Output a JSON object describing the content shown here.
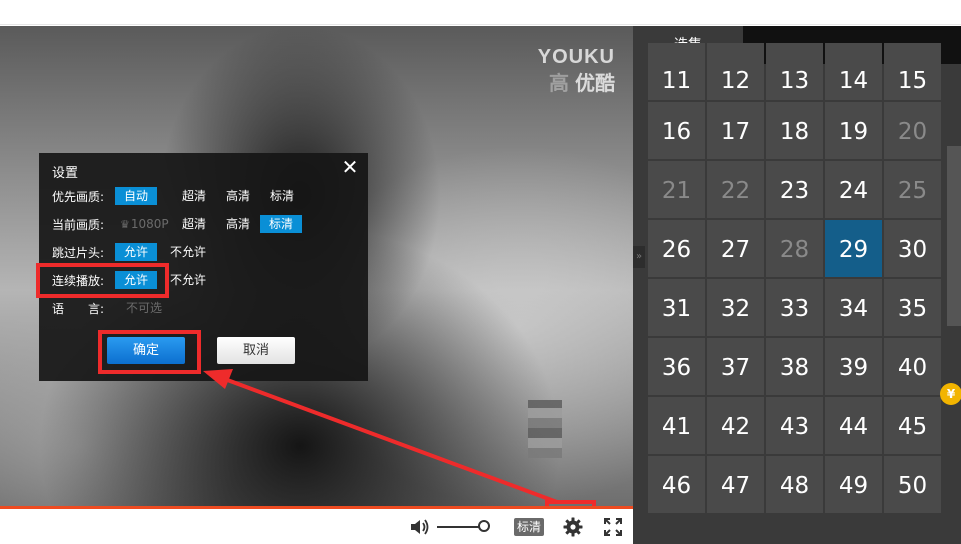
{
  "watermark": {
    "brand_en": "YOUKU",
    "brand_faded": "高",
    "brand_cn": "优酷"
  },
  "settings": {
    "title": "设置",
    "close_glyph": "✕",
    "rows": {
      "preferred_quality": {
        "label": "优先画质:",
        "options": [
          "自动",
          "超清",
          "高清",
          "标清"
        ],
        "selected": "自动"
      },
      "current_quality": {
        "label": "当前画质:",
        "crown_glyph": "♛",
        "options": [
          "1080P",
          "超清",
          "高清",
          "标清"
        ],
        "selected": "标清"
      },
      "skip_intro": {
        "label": "跳过片头:",
        "options": [
          "允许",
          "不允许"
        ],
        "selected": "允许"
      },
      "continuous_play": {
        "label": "连续播放:",
        "options": [
          "允许",
          "不允许"
        ],
        "selected": "允许"
      },
      "language": {
        "label": "语　　言:",
        "value": "不可选"
      }
    },
    "confirm_label": "确定",
    "cancel_label": "取消"
  },
  "controls": {
    "quality_label": "标清"
  },
  "episodes": {
    "tab_label": "选集",
    "rows": [
      [
        11,
        12,
        13,
        14,
        15
      ],
      [
        16,
        17,
        18,
        19,
        20
      ],
      [
        21,
        22,
        23,
        24,
        25
      ],
      [
        26,
        27,
        28,
        29,
        30
      ],
      [
        31,
        32,
        33,
        34,
        35
      ],
      [
        36,
        37,
        38,
        39,
        40
      ],
      [
        41,
        42,
        43,
        44,
        45
      ],
      [
        46,
        47,
        48,
        49,
        50
      ]
    ],
    "unavailable": [
      20,
      21,
      22,
      25,
      28
    ],
    "current": 29,
    "collapse_glyph": "»",
    "coin_glyph": "¥"
  },
  "colors": {
    "accent_blue": "#0a8fd6",
    "current_episode": "#145e8a",
    "annotation_red": "#ee2b2b",
    "progress_orange": "#ee4b21"
  }
}
